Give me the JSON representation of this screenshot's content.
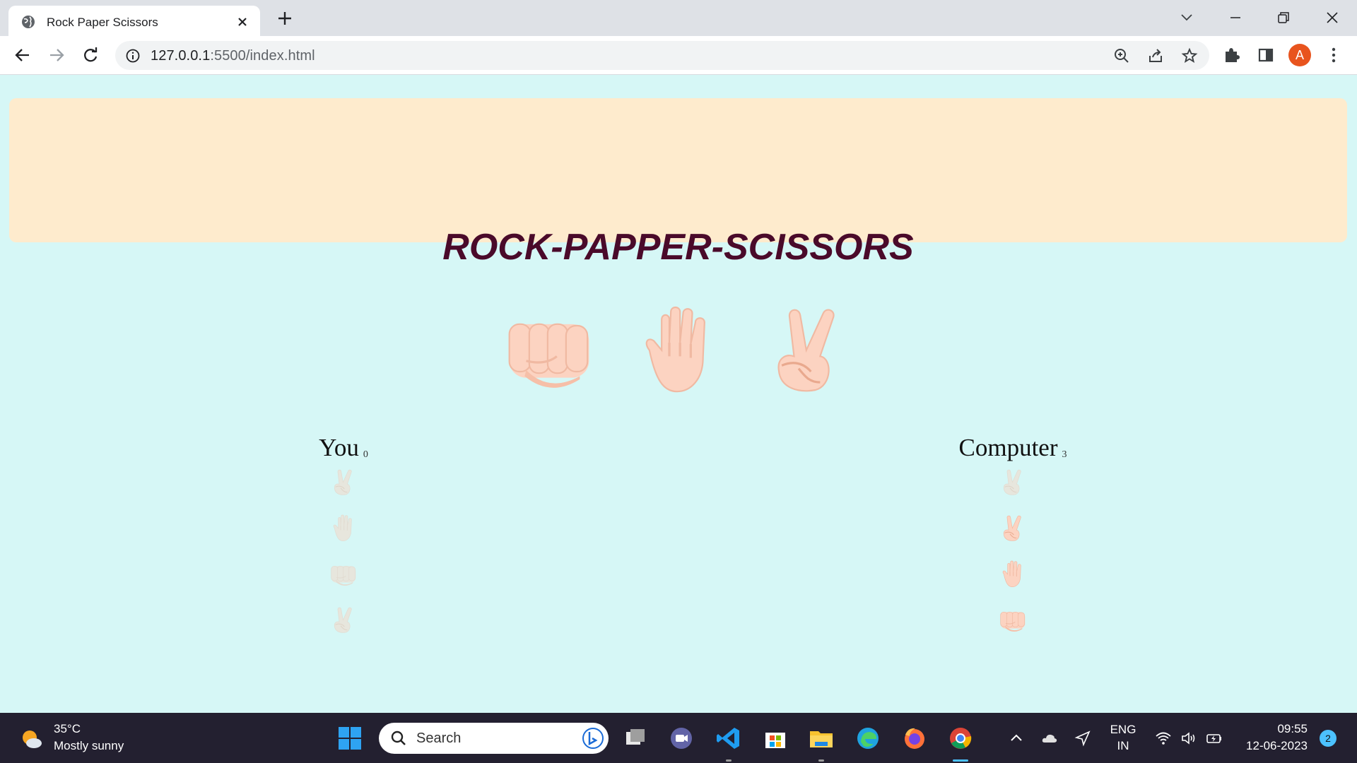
{
  "browser": {
    "tab_title": "Rock Paper Scissors",
    "url_host": "127.0.0.1",
    "url_rest": ":5500/index.html",
    "avatar_letter": "A"
  },
  "page": {
    "title": "ROCK-PAPPER-SCISSORS",
    "choices": [
      {
        "name": "rock",
        "icon": "fist-icon"
      },
      {
        "name": "paper",
        "icon": "raised-hand-icon"
      },
      {
        "name": "scissors",
        "icon": "victory-hand-icon"
      }
    ],
    "player": {
      "label": "You",
      "score": "0",
      "history": [
        "scissors",
        "paper",
        "rock",
        "scissors"
      ]
    },
    "computer": {
      "label": "Computer",
      "score": "3",
      "history": [
        "scissors",
        "scissors",
        "paper",
        "rock"
      ]
    }
  },
  "taskbar": {
    "weather_temp": "35°C",
    "weather_desc": "Mostly sunny",
    "search_placeholder": "Search",
    "lang_line1": "ENG",
    "lang_line2": "IN",
    "time": "09:55",
    "date": "12-06-2023",
    "notification_count": "2"
  },
  "colors": {
    "page_bg": "#d6f7f6",
    "banner_bg": "#feebcd",
    "title_color": "#4a0a2a",
    "skin": "#fcd3c1"
  }
}
